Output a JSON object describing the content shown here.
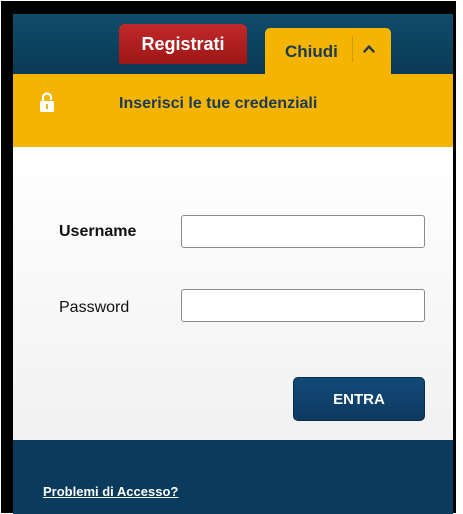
{
  "topbar": {
    "register_label": "Registrati",
    "close_label": "Chiudi",
    "chevron_icon": "chevron-up-icon"
  },
  "header": {
    "title": "Inserisci le tue credenziali",
    "lock_icon": "lock-icon",
    "background": "#f4b400"
  },
  "form": {
    "username_label": "Username",
    "username_value": "",
    "password_label": "Password",
    "password_value": "",
    "submit_label": "ENTRA"
  },
  "footer": {
    "link_label": "Problemi di Accesso?"
  },
  "colors": {
    "topbar": "#0e4c6a",
    "register_button": "#b01f1f",
    "accent_yellow": "#f4b400",
    "navy": "#0a3a5c"
  }
}
